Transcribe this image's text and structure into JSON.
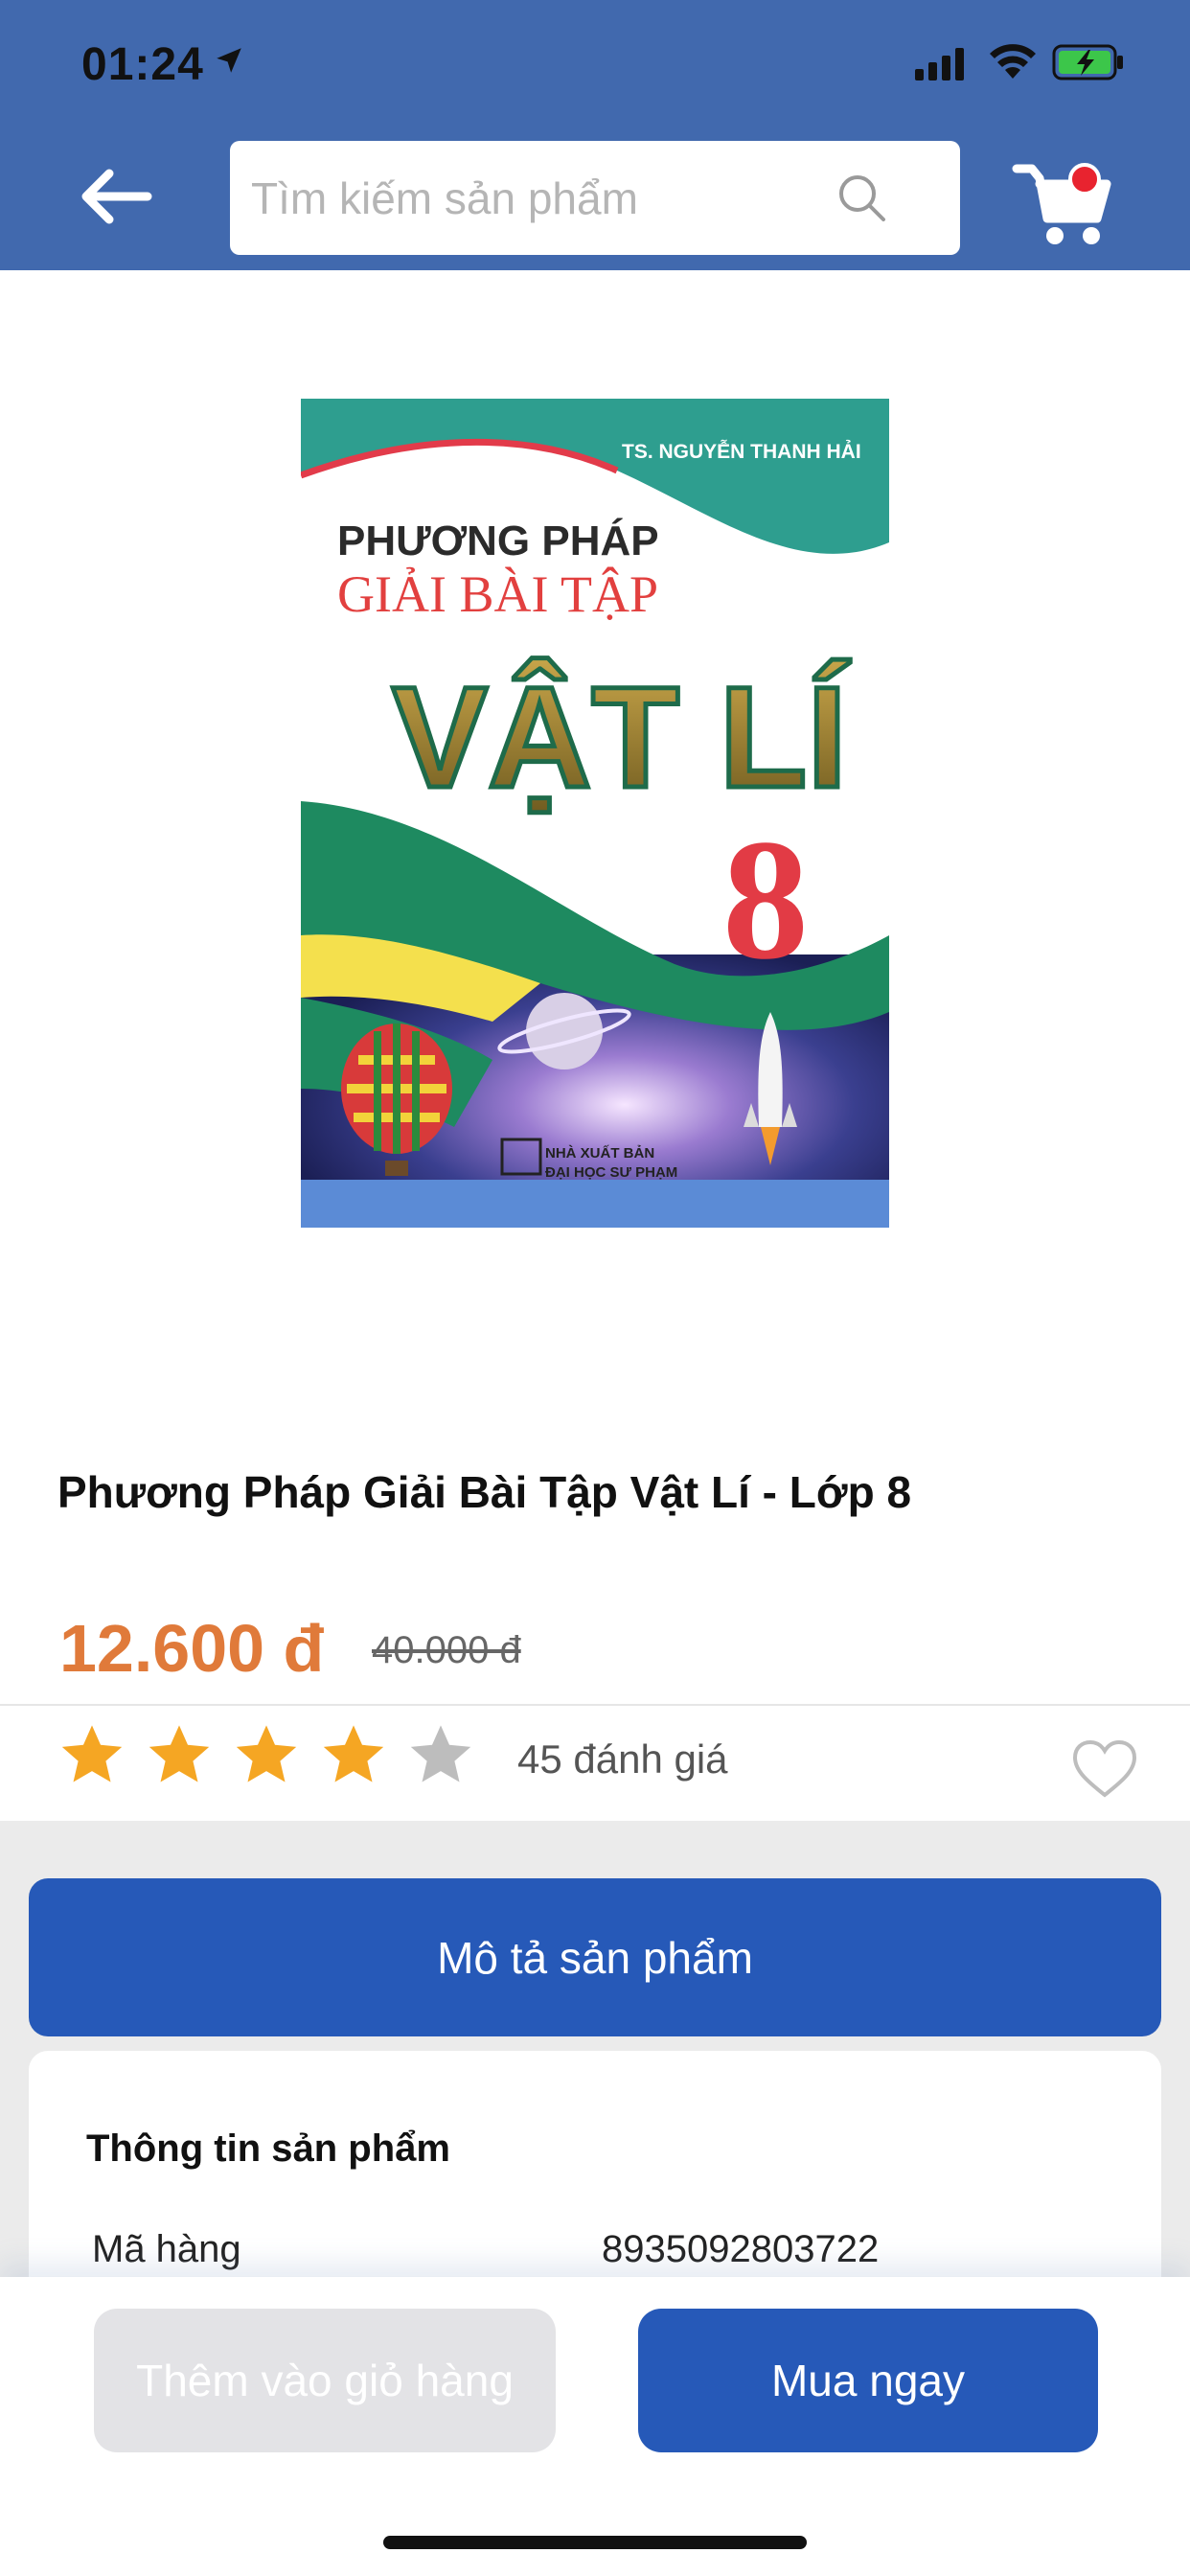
{
  "status_bar": {
    "time": "01:24",
    "location_icon": "location-arrow-icon",
    "signal_icon": "cellular-signal-icon",
    "wifi_icon": "wifi-icon",
    "battery_icon": "battery-charging-icon"
  },
  "header": {
    "background_color": "#4169AE",
    "back_icon": "arrow-left-icon",
    "search_placeholder": "Tìm kiếm sản phẩm",
    "search_icon": "search-icon",
    "cart_icon": "shopping-cart-icon",
    "cart_badge_color": "#E8232F"
  },
  "cover": {
    "author": "TS. NGUYỄN THANH HẢI",
    "line1": "PHƯƠNG PHÁP",
    "line2": "GIẢI BÀI TẬP",
    "subject": "VẬT LÍ",
    "grade": "8",
    "publisher_line1": "NHÀ XUẤT BẢN",
    "publisher_line2": "ĐẠI HỌC SƯ PHẠM"
  },
  "product": {
    "title": "Phương Pháp Giải Bài Tập Vật Lí - Lớp 8",
    "price": "12.600 đ",
    "old_price": "40.000 đ",
    "price_color": "#E07A3A",
    "rating": 4,
    "rating_max": 5,
    "star_color": "#F5A623",
    "review_count": "45 đánh giá",
    "favorite_icon": "heart-outline-icon"
  },
  "description_button": {
    "label": "Mô tả sản phẩm",
    "color": "#2659B8"
  },
  "info": {
    "heading": "Thông tin sản phẩm",
    "rows": [
      {
        "key": "Mã hàng",
        "value": "8935092803722"
      }
    ]
  },
  "bottom_bar": {
    "add_to_cart_label": "Thêm vào giỏ hàng",
    "buy_now_label": "Mua ngay"
  }
}
